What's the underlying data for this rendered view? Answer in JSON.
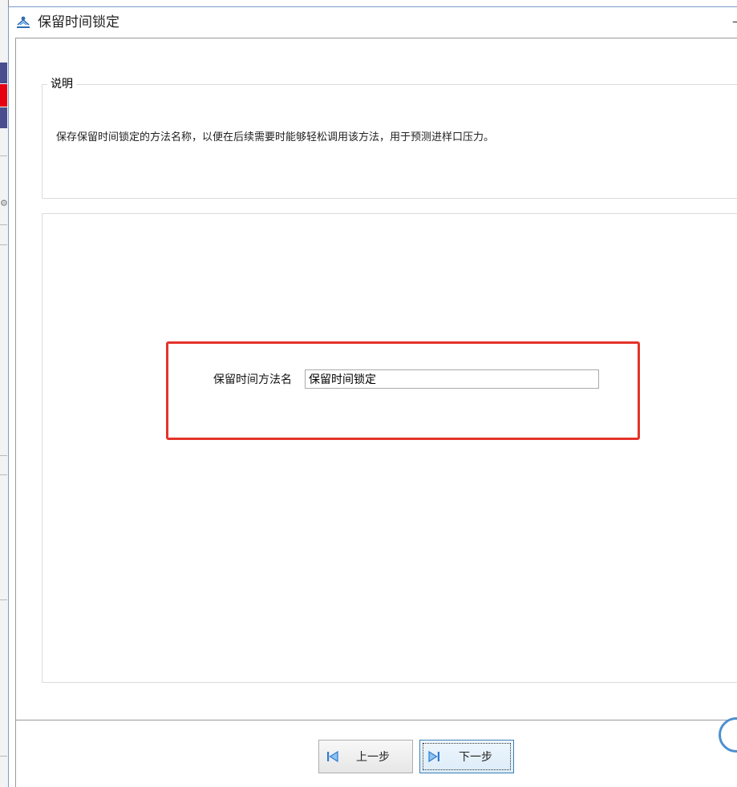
{
  "window": {
    "title": "保留时间锁定",
    "title_controls": "–"
  },
  "description": {
    "legend": "说明",
    "text": "保存保留时间锁定的方法名称，以便在后续需要时能够轻松调用该方法，用于预测进样口压力。"
  },
  "form": {
    "method_name_label": "保留时间方法名",
    "method_name_value": "保留时间锁定"
  },
  "footer": {
    "prev_label": "上一步",
    "next_label": "下一步"
  },
  "colors": {
    "highlight": "#e5332a",
    "window_border": "#7a9cc6",
    "focused_button_border": "#3c7fb1"
  },
  "icons": {
    "app": "app-logo-icon",
    "prev": "skip-back-icon",
    "next": "skip-forward-icon"
  }
}
